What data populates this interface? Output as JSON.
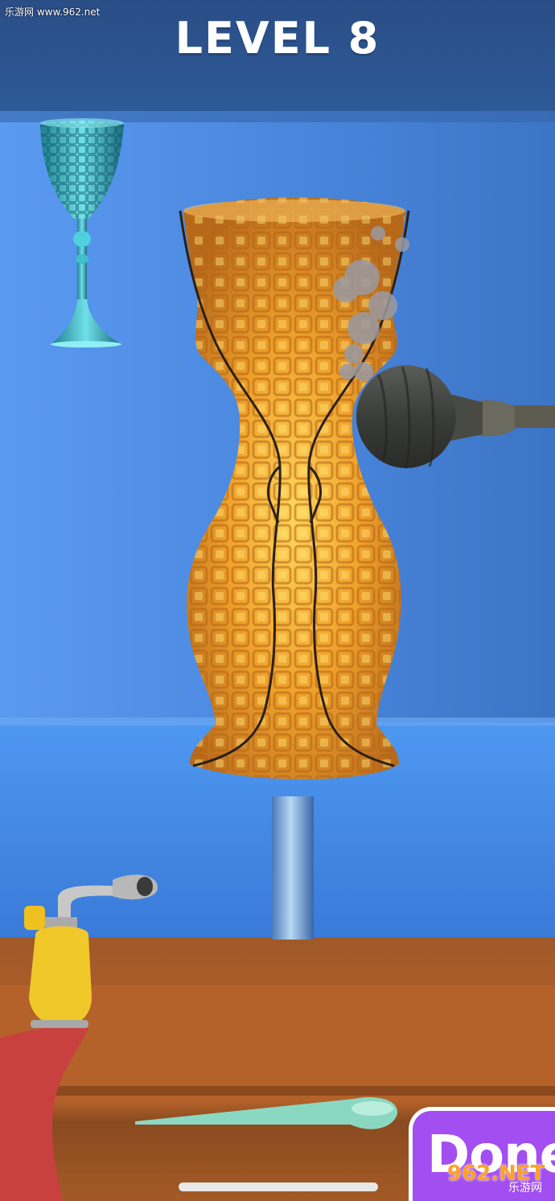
{
  "hud": {
    "level_label": "LEVEL 8",
    "done_label": "Done"
  },
  "watermarks": {
    "top_left": "乐游网 www.962.net",
    "bottom_right_logo": "962.NET",
    "bottom_right_cn": "乐游网"
  },
  "colors": {
    "header": "#2a4d86",
    "wall": "#3f7fd2",
    "table": "#b45e23",
    "glass_target": "#2aa0b0",
    "vase_glow": "#f2a22a",
    "done_button": "#a24ef0"
  },
  "icons": {
    "target_shape": "goblet-icon",
    "blow_tool": "blowpipe-icon",
    "heat_tool": "torch-icon",
    "shaping_tool": "tweezers-icon"
  }
}
